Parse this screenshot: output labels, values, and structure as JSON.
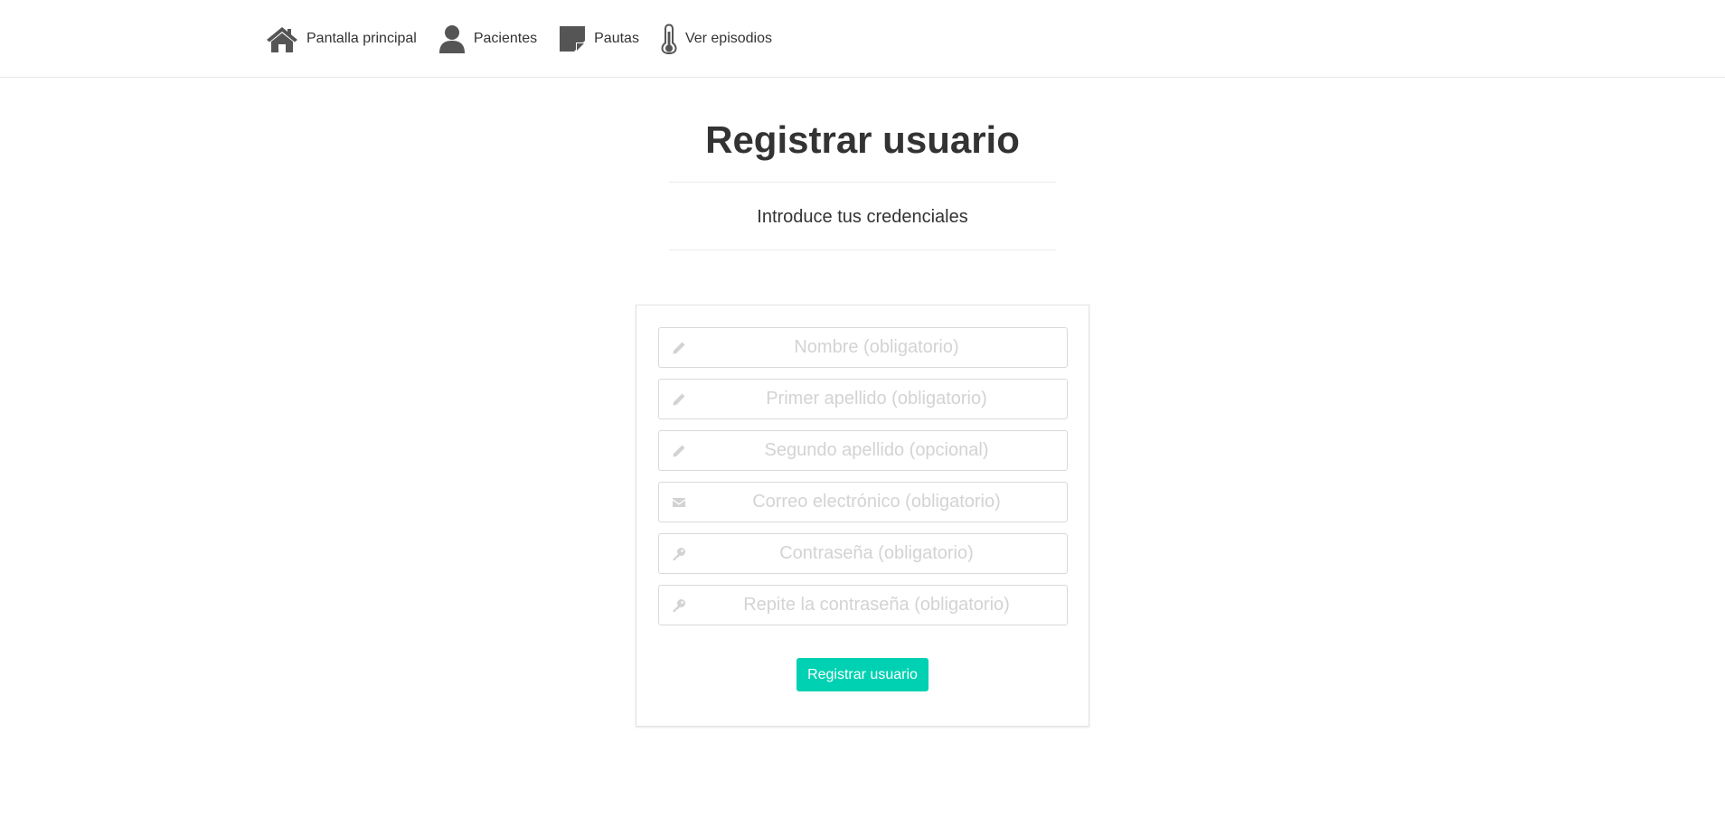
{
  "nav": {
    "items": [
      {
        "label": "Pantalla principal",
        "icon": "home-icon"
      },
      {
        "label": "Pacientes",
        "icon": "user-icon"
      },
      {
        "label": "Pautas",
        "icon": "sticky-note-icon"
      },
      {
        "label": "Ver episodios",
        "icon": "thermometer-icon"
      }
    ]
  },
  "header": {
    "title": "Registrar usuario",
    "subtitle": "Introduce tus credenciales"
  },
  "form": {
    "fields": [
      {
        "placeholder": "Nombre (obligatorio)",
        "value": "",
        "icon": "pencil-icon"
      },
      {
        "placeholder": "Primer apellido (obligatorio)",
        "value": "",
        "icon": "pencil-icon"
      },
      {
        "placeholder": "Segundo apellido (opcional)",
        "value": "",
        "icon": "pencil-icon"
      },
      {
        "placeholder": "Correo electrónico (obligatorio)",
        "value": "",
        "icon": "envelope-icon"
      },
      {
        "placeholder": "Contraseña (obligatorio)",
        "value": "",
        "icon": "key-icon"
      },
      {
        "placeholder": "Repite la contraseña (obligatorio)",
        "value": "",
        "icon": "key-icon"
      }
    ],
    "submit_label": "Registrar usuario"
  },
  "colors": {
    "accent": "#00d1b2",
    "text": "#333333",
    "icon": "#555555",
    "placeholder": "#d3d3d3",
    "border": "#d9d9d9"
  }
}
